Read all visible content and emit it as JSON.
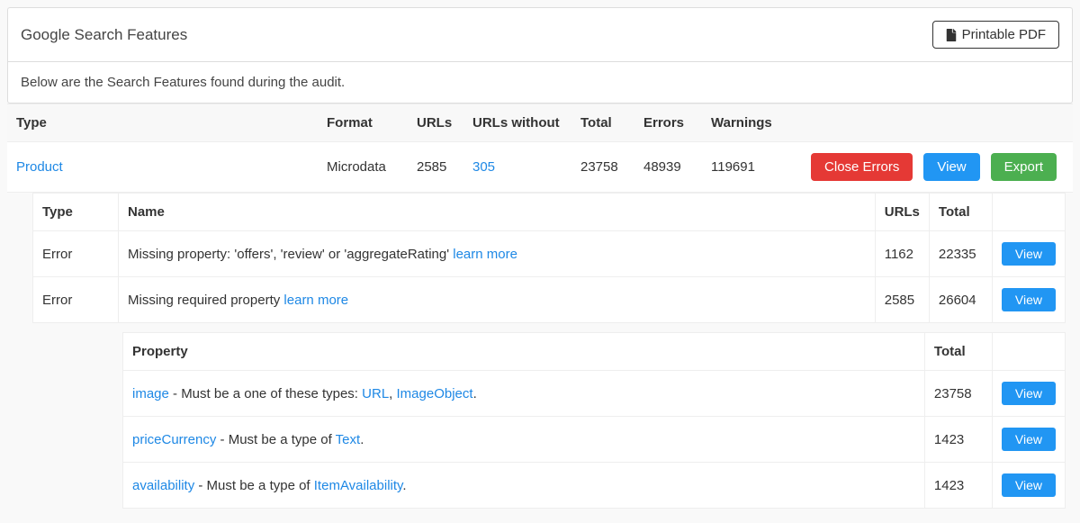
{
  "header": {
    "title": "Google Search Features",
    "printable_label": "Printable PDF"
  },
  "subtext": "Below are the Search Features found during the audit.",
  "main_table": {
    "headers": {
      "type": "Type",
      "format": "Format",
      "urls": "URLs",
      "urls_without": "URLs without",
      "total": "Total",
      "errors": "Errors",
      "warnings": "Warnings"
    },
    "row": {
      "type": "Product",
      "format": "Microdata",
      "urls": "2585",
      "urls_without": "305",
      "total": "23758",
      "errors": "48939",
      "warnings": "119691",
      "close_errors": "Close Errors",
      "view": "View",
      "export": "Export"
    }
  },
  "errors_table": {
    "headers": {
      "type": "Type",
      "name": "Name",
      "urls": "URLs",
      "total": "Total"
    },
    "rows": [
      {
        "type": "Error",
        "name_pre": "Missing property: 'offers', 'review' or 'aggregateRating' ",
        "learn": "learn more",
        "urls": "1162",
        "total": "22335",
        "view": "View"
      },
      {
        "type": "Error",
        "name_pre": "Missing required property ",
        "learn": "learn more",
        "urls": "2585",
        "total": "26604",
        "view": "View"
      }
    ]
  },
  "properties_table": {
    "headers": {
      "property": "Property",
      "total": "Total"
    },
    "rows": [
      {
        "link1": "image",
        "mid": " - Must be a one of these types: ",
        "link2": "URL",
        "sep": ", ",
        "link3": "ImageObject",
        "end": ".",
        "total": "23758",
        "view": "View"
      },
      {
        "link1": "priceCurrency",
        "mid": " - Must be a type of ",
        "link2": "Text",
        "sep": "",
        "link3": "",
        "end": ".",
        "total": "1423",
        "view": "View"
      },
      {
        "link1": "availability",
        "mid": " - Must be a type of ",
        "link2": "ItemAvailability",
        "sep": "",
        "link3": "",
        "end": ".",
        "total": "1423",
        "view": "View"
      }
    ]
  }
}
